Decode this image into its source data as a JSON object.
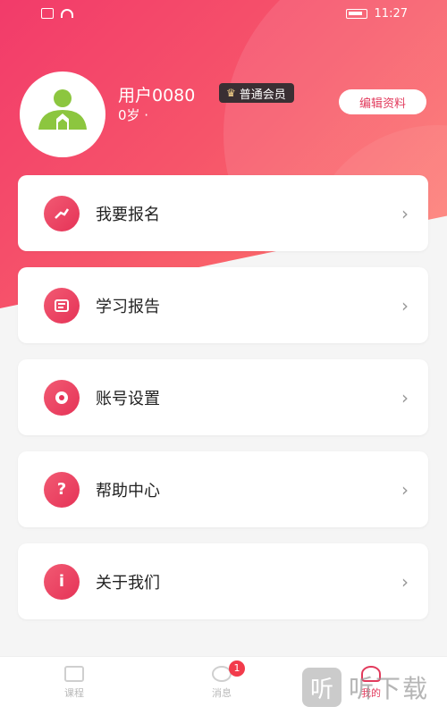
{
  "status_bar": {
    "time": "11:27"
  },
  "profile": {
    "username": "用户0080",
    "member_level": "普通会员",
    "age": "0岁 ·",
    "edit_label": "编辑资料"
  },
  "menu": [
    {
      "label": "我要报名",
      "icon": "signup-icon"
    },
    {
      "label": "学习报告",
      "icon": "report-icon"
    },
    {
      "label": "账号设置",
      "icon": "settings-icon"
    },
    {
      "label": "帮助中心",
      "icon": "help-icon"
    },
    {
      "label": "关于我们",
      "icon": "info-icon"
    }
  ],
  "menu_icon_glyphs": {
    "help": "?",
    "info": "i"
  },
  "tabs": [
    {
      "label": "课程"
    },
    {
      "label": "消息",
      "badge": "1"
    },
    {
      "label": "我的"
    }
  ],
  "watermark": {
    "text": "听下载"
  },
  "colors": {
    "accent": "#e23a5c",
    "gradient_start": "#f23b6a",
    "gradient_end": "#ff7b6b"
  }
}
